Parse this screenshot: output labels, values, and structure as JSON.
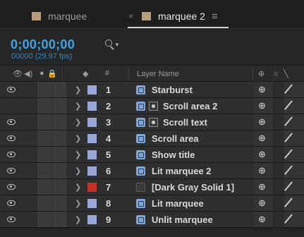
{
  "tabs": [
    {
      "label": "marquee",
      "active": false
    },
    {
      "label": "marquee 2",
      "active": true
    }
  ],
  "tab_close_glyph": "×",
  "tab_menu_glyph": "≡",
  "timecode": "0;00;00;00",
  "fps": "00000 (29.97 fps)",
  "header": {
    "hash": "#",
    "layer_name": "Layer Name"
  },
  "colors": {
    "timecode": "#3fa4e4",
    "comp_swatch": "#b89d7a",
    "label_lavender": "#9aa6d6",
    "label_red": "#c3302c"
  },
  "layers": [
    {
      "num": "1",
      "name": "Starburst",
      "visible": true,
      "label_color": "#9aa6d6",
      "icon": "precomp-icon",
      "sub_icon": false
    },
    {
      "num": "2",
      "name": "Scroll area 2",
      "visible": false,
      "label_color": "#9aa6d6",
      "icon": "precomp-icon",
      "sub_icon": true
    },
    {
      "num": "3",
      "name": "Scroll text",
      "visible": true,
      "label_color": "#9aa6d6",
      "icon": "precomp-icon",
      "sub_icon": true
    },
    {
      "num": "4",
      "name": "Scroll area",
      "visible": true,
      "label_color": "#9aa6d6",
      "icon": "precomp-icon",
      "sub_icon": false
    },
    {
      "num": "5",
      "name": "Show title",
      "visible": true,
      "label_color": "#9aa6d6",
      "icon": "precomp-icon",
      "sub_icon": false
    },
    {
      "num": "6",
      "name": "Lit marquee 2",
      "visible": true,
      "label_color": "#9aa6d6",
      "icon": "precomp-icon",
      "sub_icon": false
    },
    {
      "num": "7",
      "name": "[Dark Gray Solid 1]",
      "visible": true,
      "label_color": "#c3302c",
      "icon": "solid-icon",
      "sub_icon": false
    },
    {
      "num": "8",
      "name": "Lit marquee",
      "visible": true,
      "label_color": "#9aa6d6",
      "icon": "precomp-icon",
      "sub_icon": false
    },
    {
      "num": "9",
      "name": "Unlit marquee",
      "visible": true,
      "label_color": "#9aa6d6",
      "icon": "precomp-icon",
      "sub_icon": false
    }
  ]
}
